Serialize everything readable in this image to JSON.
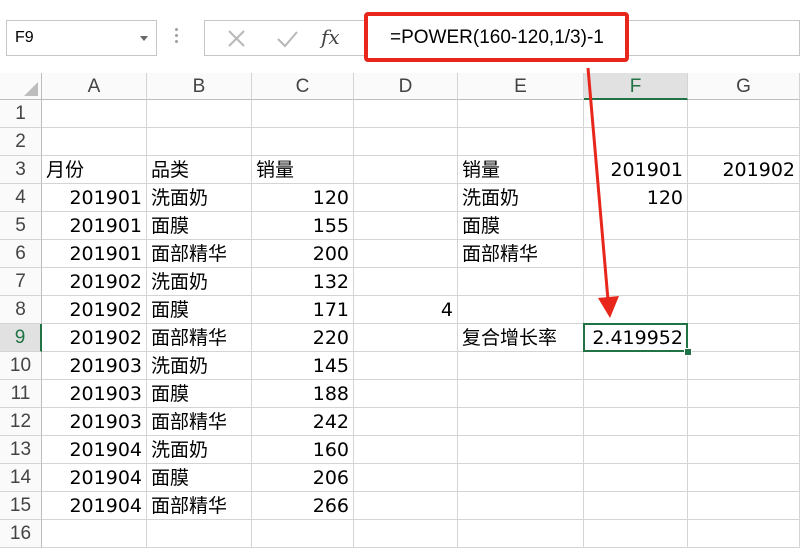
{
  "name_box": {
    "value": "F9"
  },
  "formula_bar": {
    "formula": "=POWER(160-120,1/3)-1",
    "cancel_icon": "cross-icon",
    "enter_icon": "check-icon",
    "fx_label": "fx"
  },
  "colors": {
    "accent": "#217346",
    "highlight": "#e8271c"
  },
  "columns": [
    "A",
    "B",
    "C",
    "D",
    "E",
    "F",
    "G"
  ],
  "rows": [
    "1",
    "2",
    "3",
    "4",
    "5",
    "6",
    "7",
    "8",
    "9",
    "10",
    "11",
    "12",
    "13",
    "14",
    "15",
    "16"
  ],
  "selected_cell": "F9",
  "cells": {
    "A3": "月份",
    "B3": "品类",
    "C3": "销量",
    "A4": "201901",
    "B4": "洗面奶",
    "C4": "120",
    "A5": "201901",
    "B5": "面膜",
    "C5": "155",
    "A6": "201901",
    "B6": "面部精华",
    "C6": "200",
    "A7": "201902",
    "B7": "洗面奶",
    "C7": "132",
    "A8": "201902",
    "B8": "面膜",
    "C8": "171",
    "A9": "201902",
    "B9": "面部精华",
    "C9": "220",
    "A10": "201903",
    "B10": "洗面奶",
    "C10": "145",
    "A11": "201903",
    "B11": "面膜",
    "C11": "188",
    "A12": "201903",
    "B12": "面部精华",
    "C12": "242",
    "A13": "201904",
    "B13": "洗面奶",
    "C13": "160",
    "A14": "201904",
    "B14": "面膜",
    "C14": "206",
    "A15": "201904",
    "B15": "面部精华",
    "C15": "266",
    "E3": "销量",
    "F3": "201901",
    "G3": "201902",
    "E4": "洗面奶",
    "F4": "120",
    "E5": "面膜",
    "E6": "面部精华",
    "D8": "4",
    "E9": "复合增长率",
    "F9": "2.419952"
  }
}
